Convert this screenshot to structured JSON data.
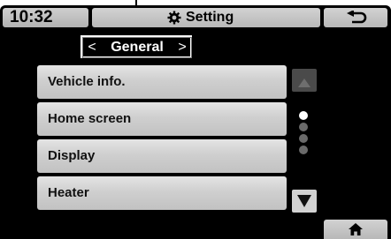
{
  "status": {
    "time": "10:32"
  },
  "header": {
    "title": "Setting",
    "title_icon": "gear-icon",
    "back_icon": "back-arrow-icon"
  },
  "category": {
    "label": "General",
    "prev_glyph": "<",
    "next_glyph": ">"
  },
  "menu": {
    "items": [
      {
        "label": "Vehicle info."
      },
      {
        "label": "Home screen"
      },
      {
        "label": "Display"
      },
      {
        "label": "Heater"
      }
    ]
  },
  "pagination": {
    "total": 4,
    "active_index": 0
  },
  "footer": {
    "home_icon": "home-icon"
  }
}
